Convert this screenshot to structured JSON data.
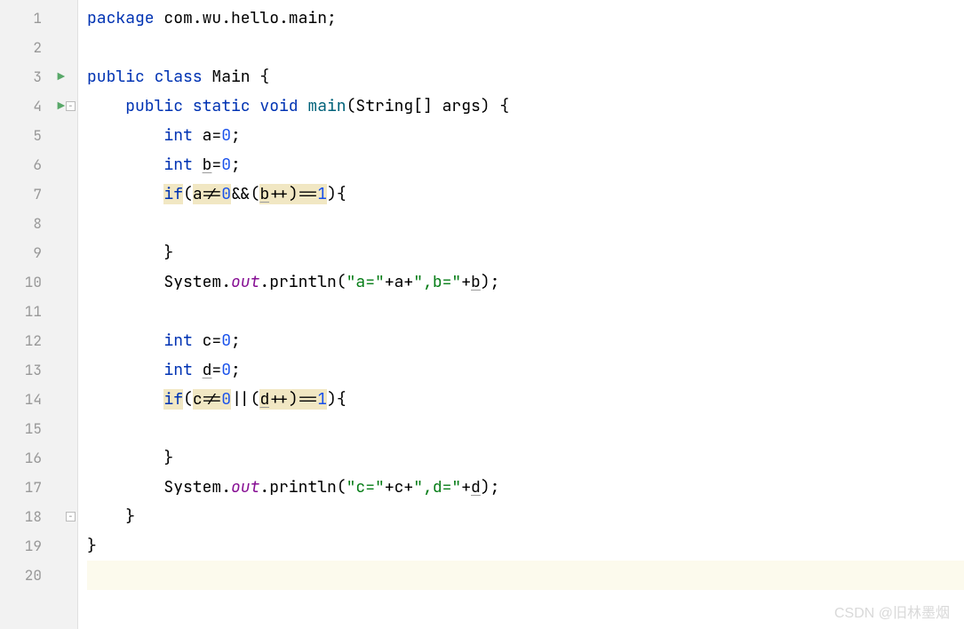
{
  "gutter": {
    "lines": [
      1,
      2,
      3,
      4,
      5,
      6,
      7,
      8,
      9,
      10,
      11,
      12,
      13,
      14,
      15,
      16,
      17,
      18,
      19,
      20
    ],
    "runMarkers": [
      3,
      4
    ],
    "foldMarkers": {
      "4": "open",
      "18": "close"
    },
    "currentLine": 20
  },
  "code": {
    "tokens": [
      [
        {
          "t": "package ",
          "c": "kw"
        },
        {
          "t": "com.wu.hello.main;",
          "c": "ident"
        }
      ],
      [],
      [
        {
          "t": "public class ",
          "c": "kw"
        },
        {
          "t": "Main ",
          "c": "type"
        },
        {
          "t": "{",
          "c": "punct"
        }
      ],
      [
        {
          "t": "    ",
          "c": ""
        },
        {
          "t": "public static void ",
          "c": "kw"
        },
        {
          "t": "main",
          "c": "method"
        },
        {
          "t": "(String[] args) {",
          "c": "punct"
        }
      ],
      [
        {
          "t": "        ",
          "c": ""
        },
        {
          "t": "int ",
          "c": "kw"
        },
        {
          "t": "a=",
          "c": "ident"
        },
        {
          "t": "0",
          "c": "num"
        },
        {
          "t": ";",
          "c": "punct"
        }
      ],
      [
        {
          "t": "        ",
          "c": ""
        },
        {
          "t": "int ",
          "c": "kw"
        },
        {
          "t": "b",
          "c": "ident underline"
        },
        {
          "t": "=",
          "c": "ident"
        },
        {
          "t": "0",
          "c": "num"
        },
        {
          "t": ";",
          "c": "punct"
        }
      ],
      [
        {
          "t": "        ",
          "c": ""
        },
        {
          "t": "if",
          "c": "kw hl"
        },
        {
          "t": "(",
          "c": "punct"
        },
        {
          "t": "a!=",
          "c": "ident hl"
        },
        {
          "t": "0",
          "c": "num hl"
        },
        {
          "t": "&&(",
          "c": "ident"
        },
        {
          "t": "b",
          "c": "ident hl underline"
        },
        {
          "t": "++)==",
          "c": "ident hl"
        },
        {
          "t": "1",
          "c": "num hl"
        },
        {
          "t": "){",
          "c": "punct"
        }
      ],
      [],
      [
        {
          "t": "        }",
          "c": "punct"
        }
      ],
      [
        {
          "t": "        System.",
          "c": "ident"
        },
        {
          "t": "out",
          "c": "field"
        },
        {
          "t": ".println(",
          "c": "ident"
        },
        {
          "t": "\"a=\"",
          "c": "str"
        },
        {
          "t": "+a+",
          "c": "ident"
        },
        {
          "t": "\",b=\"",
          "c": "str"
        },
        {
          "t": "+",
          "c": "ident"
        },
        {
          "t": "b",
          "c": "ident underline"
        },
        {
          "t": ");",
          "c": "punct"
        }
      ],
      [],
      [
        {
          "t": "        ",
          "c": ""
        },
        {
          "t": "int ",
          "c": "kw"
        },
        {
          "t": "c=",
          "c": "ident"
        },
        {
          "t": "0",
          "c": "num"
        },
        {
          "t": ";",
          "c": "punct"
        }
      ],
      [
        {
          "t": "        ",
          "c": ""
        },
        {
          "t": "int ",
          "c": "kw"
        },
        {
          "t": "d",
          "c": "ident underline"
        },
        {
          "t": "=",
          "c": "ident"
        },
        {
          "t": "0",
          "c": "num"
        },
        {
          "t": ";",
          "c": "punct"
        }
      ],
      [
        {
          "t": "        ",
          "c": ""
        },
        {
          "t": "if",
          "c": "kw hl"
        },
        {
          "t": "(",
          "c": "punct"
        },
        {
          "t": "c!=",
          "c": "ident hl"
        },
        {
          "t": "0",
          "c": "num hl"
        },
        {
          "t": "||(",
          "c": "ident"
        },
        {
          "t": "d",
          "c": "ident hl underline"
        },
        {
          "t": "++)==",
          "c": "ident hl"
        },
        {
          "t": "1",
          "c": "num hl"
        },
        {
          "t": "){",
          "c": "punct"
        }
      ],
      [],
      [
        {
          "t": "        }",
          "c": "punct"
        }
      ],
      [
        {
          "t": "        System.",
          "c": "ident"
        },
        {
          "t": "out",
          "c": "field"
        },
        {
          "t": ".println(",
          "c": "ident"
        },
        {
          "t": "\"c=\"",
          "c": "str"
        },
        {
          "t": "+c+",
          "c": "ident"
        },
        {
          "t": "\",d=\"",
          "c": "str"
        },
        {
          "t": "+",
          "c": "ident"
        },
        {
          "t": "d",
          "c": "ident underline"
        },
        {
          "t": ");",
          "c": "punct"
        }
      ],
      [
        {
          "t": "    }",
          "c": "punct"
        }
      ],
      [
        {
          "t": "}",
          "c": "punct"
        }
      ],
      []
    ]
  },
  "watermark": "CSDN @旧林墨烟"
}
